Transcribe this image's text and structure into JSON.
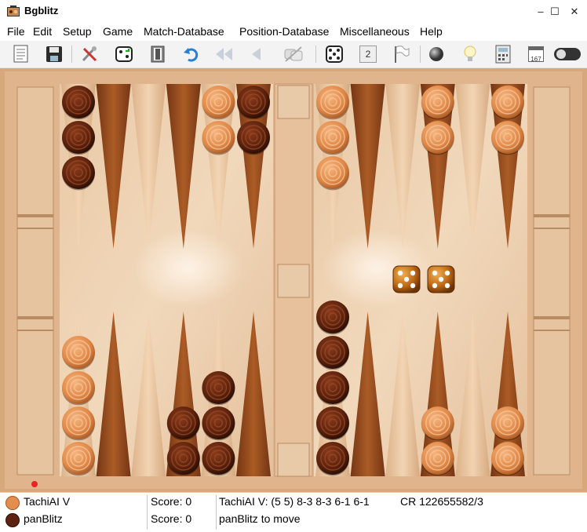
{
  "window": {
    "title": "Bgblitz",
    "minimize": "–",
    "maximize": "☐",
    "close": "✕"
  },
  "menu": [
    "File",
    "Edit",
    "Setup",
    "Game",
    "Match-Database",
    "Position-Database",
    "Miscellaneous",
    "Help"
  ],
  "toolbar": {
    "icons": [
      "new-document-icon",
      "save-icon",
      "tools-icon",
      "dice-roll-icon",
      "door-exit-icon",
      "undo-icon",
      "rewind-icon",
      "step-back-icon",
      "hint-disabled-icon",
      "dice-icon",
      "doubling-cube-icon",
      "resign-flag-icon",
      "ball-icon",
      "lightbulb-icon",
      "calculator-icon",
      "calendar-icon",
      "toggle-switch-icon"
    ],
    "cube_value": "2",
    "calendar_day": "167"
  },
  "board": {
    "colors": {
      "light_checker": "#e38e4c",
      "dark_checker": "#5d2310",
      "frame": "#dcae86",
      "bar": "#e6c19c"
    },
    "dice": [
      5,
      5
    ],
    "points": [
      {
        "point": 1,
        "color": "light",
        "count": 2
      },
      {
        "point": 3,
        "color": "light",
        "count": 2
      },
      {
        "point": 6,
        "color": "dark",
        "count": 5
      },
      {
        "point": 8,
        "color": "dark",
        "count": 3
      },
      {
        "point": 9,
        "color": "dark",
        "count": 2
      },
      {
        "point": 12,
        "color": "light",
        "count": 4
      },
      {
        "point": 13,
        "color": "dark",
        "count": 3
      },
      {
        "point": 17,
        "color": "light",
        "count": 2
      },
      {
        "point": 18,
        "color": "dark",
        "count": 2
      },
      {
        "point": 19,
        "color": "light",
        "count": 3
      },
      {
        "point": 22,
        "color": "light",
        "count": 2
      },
      {
        "point": 24,
        "color": "light",
        "count": 2
      }
    ]
  },
  "status": {
    "player1": {
      "name": "TachiAI V",
      "score_label": "Score: 0",
      "color": "#e38e4c"
    },
    "player2": {
      "name": "panBlitz",
      "score_label": "Score: 0",
      "color": "#5d2310"
    },
    "last_move": "TachiAI V: (5 5) 8-3 8-3 6-1 6-1",
    "cr": "CR 122655582/3",
    "to_move": "panBlitz to move"
  }
}
